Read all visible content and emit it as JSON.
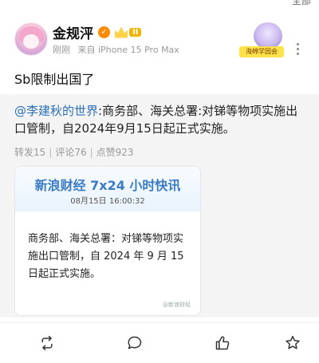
{
  "status_top": {
    "partial_text": "全部"
  },
  "post": {
    "author": {
      "name": "金规泙",
      "level": "II"
    },
    "meta": {
      "time": "刚刚",
      "source": "来自 iPhone 15 Pro Max"
    },
    "sticker_text": "海绵学园会",
    "text": "Sb限制出国了"
  },
  "repost": {
    "mention": "@李建秋的世界",
    "text": ":商务部、海关总署:对锑等物项实施出口管制，自2024年9月15日起正式实施。",
    "stats": {
      "repost": "转发15",
      "comment": "评论76",
      "like": "点赞923"
    },
    "news_card": {
      "title": "新浪财经 7x24 小时快讯",
      "time": "08月15日 16:00:32",
      "body": "商务部、海关总署：对锑等物项实施出口管制，自 2024 年 9 月 15 日起正式实施。",
      "watermark": "@新浪财经"
    }
  },
  "actions": [
    {
      "name": "repost-icon"
    },
    {
      "name": "comment-icon"
    },
    {
      "name": "like-icon"
    },
    {
      "name": "share-icon"
    }
  ],
  "colors": {
    "accent": "#2c6fb8",
    "news_blue": "#3a7bc6",
    "repost_bg": "#f4f4f4"
  }
}
